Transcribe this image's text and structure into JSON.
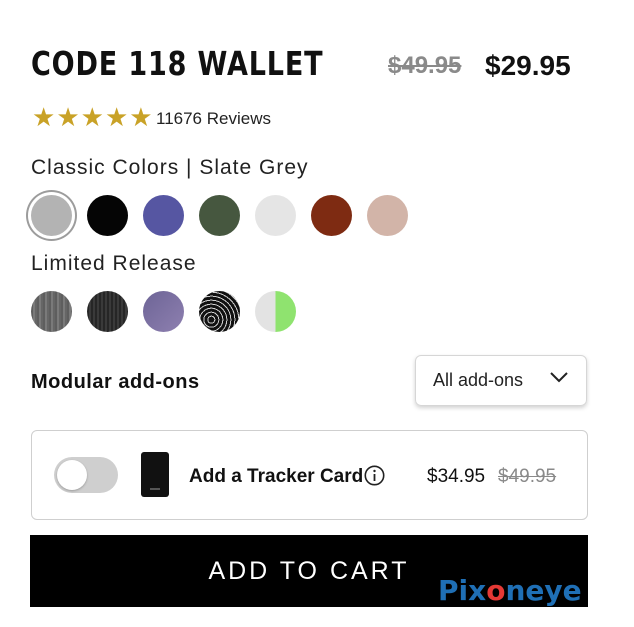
{
  "product": {
    "title": "CODE 118 WALLET",
    "price_original": "$49.95",
    "price_sale": "$29.95",
    "rating": 5,
    "reviews_label": "11676 Reviews"
  },
  "colors": {
    "classic_label": "Classic Colors | Slate Grey",
    "classic": [
      {
        "name": "slate-grey",
        "color": "#b3b3b3",
        "selected": true
      },
      {
        "name": "black",
        "color": "#050505"
      },
      {
        "name": "blue",
        "color": "#5656a2"
      },
      {
        "name": "green",
        "color": "#46573f"
      },
      {
        "name": "light-grey",
        "color": "#e5e5e5"
      },
      {
        "name": "rust",
        "color": "#7e2b12"
      },
      {
        "name": "blush",
        "color": "#d2b4a8"
      }
    ],
    "limited_label": "Limited Release",
    "limited": [
      {
        "name": "grey-texture",
        "color": "#6b6b6b"
      },
      {
        "name": "charcoal-texture",
        "color": "#2f2f2f"
      },
      {
        "name": "purple-texture",
        "color": "#7a6fa0"
      },
      {
        "name": "topo-black",
        "color": "#1a1a1a"
      },
      {
        "name": "split-green",
        "color": "#8fe36f"
      }
    ]
  },
  "addons": {
    "label": "Modular add-ons",
    "dropdown_value": "All add-ons",
    "item": {
      "name": "Add a Tracker Card",
      "price": "$34.95",
      "price_original": "$49.95",
      "enabled": false
    }
  },
  "cart_button": "ADD TO CART",
  "watermark": {
    "part1": "Pix",
    "dot": "o",
    "part2": "neye"
  }
}
